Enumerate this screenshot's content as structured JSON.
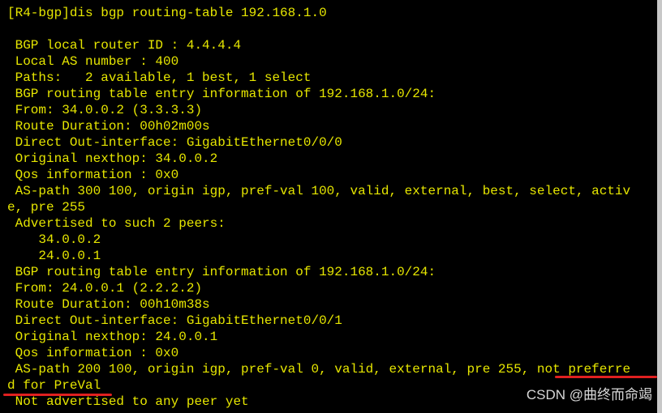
{
  "terminal": {
    "lines": [
      "[R4-bgp]dis bgp routing-table 192.168.1.0",
      "",
      " BGP local router ID : 4.4.4.4",
      " Local AS number : 400",
      " Paths:   2 available, 1 best, 1 select",
      " BGP routing table entry information of 192.168.1.0/24:",
      " From: 34.0.0.2 (3.3.3.3)",
      " Route Duration: 00h02m00s",
      " Direct Out-interface: GigabitEthernet0/0/0",
      " Original nexthop: 34.0.0.2",
      " Qos information : 0x0",
      " AS-path 300 100, origin igp, pref-val 100, valid, external, best, select, activ",
      "e, pre 255",
      " Advertised to such 2 peers:",
      "    34.0.0.2",
      "    24.0.0.1",
      " BGP routing table entry information of 192.168.1.0/24:",
      " From: 24.0.0.1 (2.2.2.2)",
      " Route Duration: 00h10m38s",
      " Direct Out-interface: GigabitEthernet0/0/1",
      " Original nexthop: 24.0.0.1",
      " Qos information : 0x0",
      " AS-path 200 100, origin igp, pref-val 0, valid, external, pre 255, not preferre",
      "d for PreVal",
      " Not advertised to any peer yet"
    ]
  },
  "watermark": "CSDN @曲终而命竭",
  "colors": {
    "text": "#e6e600",
    "background": "#000000",
    "annotation": "#e02020"
  }
}
